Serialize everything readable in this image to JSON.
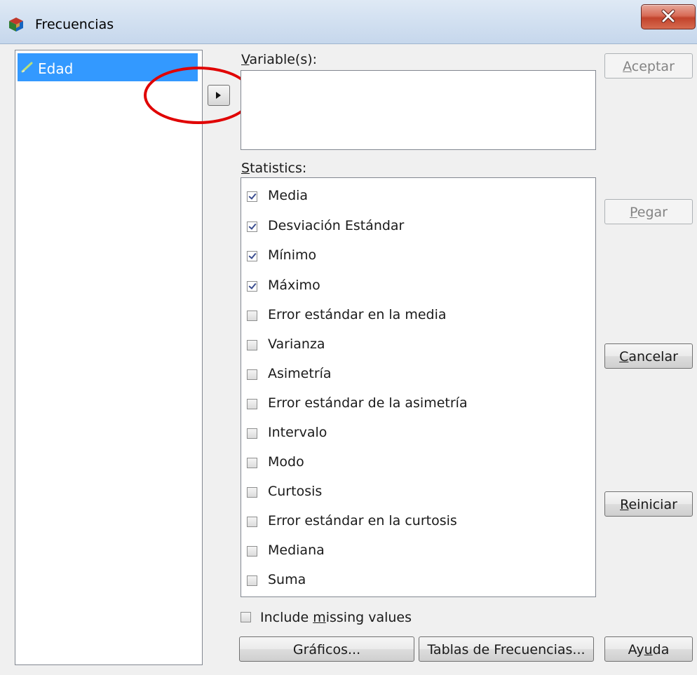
{
  "window": {
    "title": "Frecuencias",
    "close_label": "X"
  },
  "variables": {
    "items": [
      {
        "label": "Edad"
      }
    ]
  },
  "move_button": {
    "icon": "triangle-right-icon"
  },
  "variable_target": {
    "label_hot": "V",
    "label_rest": "ariable(s):"
  },
  "statistics": {
    "label_hot": "S",
    "label_rest": "tatistics:",
    "items": [
      {
        "label": "Media",
        "checked": true
      },
      {
        "label": "Desviación Estándar",
        "checked": true
      },
      {
        "label": "Mínimo",
        "checked": true
      },
      {
        "label": "Máximo",
        "checked": true
      },
      {
        "label": "Error estándar en la media",
        "checked": false
      },
      {
        "label": "Varianza",
        "checked": false
      },
      {
        "label": "Asimetría",
        "checked": false
      },
      {
        "label": "Error estándar de la asimetría",
        "checked": false
      },
      {
        "label": "Intervalo",
        "checked": false
      },
      {
        "label": "Modo",
        "checked": false
      },
      {
        "label": "Curtosis",
        "checked": false
      },
      {
        "label": "Error estándar en la curtosis",
        "checked": false
      },
      {
        "label": "Mediana",
        "checked": false
      },
      {
        "label": "Suma",
        "checked": false
      }
    ]
  },
  "include_missing": {
    "before": "Include ",
    "hot": "m",
    "after": "issing values",
    "checked": false
  },
  "buttons": {
    "aceptar": {
      "hot": "A",
      "rest": "ceptar"
    },
    "pegar": {
      "hot": "P",
      "rest": "egar"
    },
    "cancelar": {
      "hot": "C",
      "rest": "ancelar"
    },
    "reiniciar": {
      "hot": "R",
      "rest": "einiciar"
    },
    "ayuda": {
      "before": "Ay",
      "hot": "u",
      "after": "da"
    },
    "graficos": "Gráficos...",
    "tablas": "Tablas de Frecuencias..."
  },
  "colors": {
    "selection": "#3399ff",
    "annotation": "#e00000",
    "close": "#c2432c"
  }
}
